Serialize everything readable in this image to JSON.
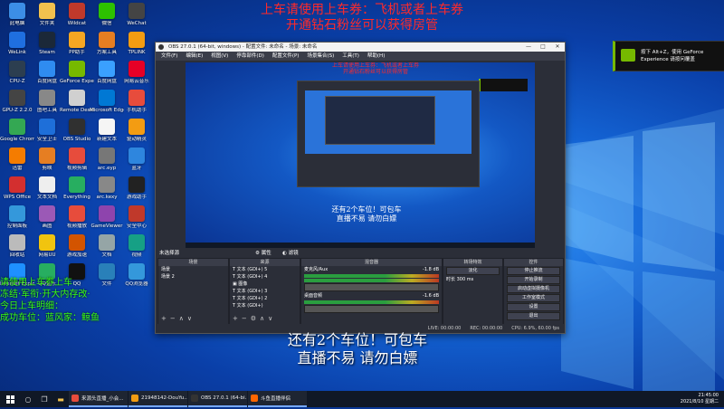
{
  "overlays": {
    "top_line1": "上车请使用上车券：飞机或者上车券",
    "top_line2": "开通钻石粉丝可以获得房管",
    "left_lines": [
      "请使用上车券上车",
      "冻结·军衔·开大内存改·",
      "今日上车明细：",
      "成功车位：蓝风家：鲸鱼"
    ],
    "bottom_line1": "还有2个车位！可包车",
    "bottom_line2": "直播不易 请勿白嫖"
  },
  "nvidia_toast": {
    "text": "按下 Alt+Z，使用 GeForce Experience 请按问覆盖"
  },
  "desktop_icons": [
    {
      "label": "此电脑",
      "color": "#3c8ee6"
    },
    {
      "label": "文件夹",
      "color": "#f2c14e"
    },
    {
      "label": "Wildcat",
      "color": "#c0392b"
    },
    {
      "label": "微信",
      "color": "#2dc100"
    },
    {
      "label": "WeChat",
      "color": "#444"
    },
    {
      "label": "WeLink",
      "color": "#1f6fe0"
    },
    {
      "label": "Steam",
      "color": "#1b2838"
    },
    {
      "label": "PP助手",
      "color": "#f5a623"
    },
    {
      "label": "方案工具",
      "color": "#e67e22"
    },
    {
      "label": "TPLINK",
      "color": "#f39c12"
    },
    {
      "label": "CPU-Z",
      "color": "#2c3e50"
    },
    {
      "label": "百度网盘",
      "color": "#2f8cf0"
    },
    {
      "label": "GeForce Experience",
      "color": "#76b900"
    },
    {
      "label": "百度网盘",
      "color": "#3aa0ff"
    },
    {
      "label": "网易云音乐",
      "color": "#e60026"
    },
    {
      "label": "GPU-Z 2.2.0",
      "color": "#444"
    },
    {
      "label": "图吧工具",
      "color": "#888"
    },
    {
      "label": "Remote Desktop",
      "color": "#d0d0d0"
    },
    {
      "label": "Microsoft Edge",
      "color": "#0078d4"
    },
    {
      "label": "手机助手",
      "color": "#e74c3c"
    },
    {
      "label": "Google Chrome",
      "color": "#34a853"
    },
    {
      "label": "安全卫士",
      "color": "#1e6fd9"
    },
    {
      "label": "OBS Studio",
      "color": "#303030"
    },
    {
      "label": "新建文本",
      "color": "#f5f5f5"
    },
    {
      "label": "驱动精灵",
      "color": "#f39c12"
    },
    {
      "label": "迅雷",
      "color": "#f57c00"
    },
    {
      "label": "剪映",
      "color": "#e67e22"
    },
    {
      "label": "视频剪辑",
      "color": "#e74c3c"
    },
    {
      "label": "arc.eyp",
      "color": "#777"
    },
    {
      "label": "蓝牙",
      "color": "#2e86de"
    },
    {
      "label": "WPS Office",
      "color": "#d32f2f"
    },
    {
      "label": "文本文档",
      "color": "#eee"
    },
    {
      "label": "Everything",
      "color": "#27ae60"
    },
    {
      "label": "arc.kexy",
      "color": "#888"
    },
    {
      "label": "游戏助手",
      "color": "#222"
    },
    {
      "label": "控制面板",
      "color": "#3498db"
    },
    {
      "label": "画图",
      "color": "#9b59b6"
    },
    {
      "label": "视频播放",
      "color": "#e74c3c"
    },
    {
      "label": "GameViewer",
      "color": "#8e44ad"
    },
    {
      "label": "安全中心",
      "color": "#c0392b"
    },
    {
      "label": "回收站",
      "color": "#bbb"
    },
    {
      "label": "网易UU",
      "color": "#f1c40f"
    },
    {
      "label": "游戏加速",
      "color": "#d35400"
    },
    {
      "label": "文档",
      "color": "#95a5a6"
    },
    {
      "label": "视频",
      "color": "#16a085"
    },
    {
      "label": "Internet Explorer",
      "color": "#1e90ff"
    },
    {
      "label": "QQ音乐",
      "color": "#27ae60"
    },
    {
      "label": "QQ",
      "color": "#111"
    },
    {
      "label": "文件",
      "color": "#2980b9"
    },
    {
      "label": "QQ浏览器",
      "color": "#3498db"
    }
  ],
  "obs": {
    "title": "OBS 27.0.1 (64-bit, windows) - 配置文件: 未命名 - 场景: 未命名",
    "menu": [
      "文件(F)",
      "编辑(E)",
      "视图(V)",
      "停靠部件(D)",
      "配置文件(P)",
      "场景集合(S)",
      "工具(T)",
      "帮助(H)"
    ],
    "win_buttons": [
      "—",
      "□",
      "✕"
    ],
    "no_source": "未选择源",
    "props_button": "属性",
    "filters_button": "滤镜",
    "nested_caption1": "还有2个车位！可包车",
    "nested_caption2": "直播不易 请勿白嫖",
    "docks": {
      "scenes": {
        "title": "场景",
        "items": [
          "场景",
          "场景 2"
        ]
      },
      "sources": {
        "title": "来源",
        "items": [
          "文本 (GDI+) 5",
          "文本 (GDI+) 4",
          "图像",
          "文本 (GDI+) 3",
          "文本 (GDI+) 2",
          "文本 (GDI+)"
        ]
      },
      "mixer": {
        "title": "混音器",
        "ch1": "麦克风/Aux",
        "ch1_db": "-1.8 dB",
        "ch2": "桌面音频",
        "ch2_db": "-1.6 dB"
      },
      "transitions": {
        "title": "转场特效",
        "type": "淡化",
        "duration_label": "时长",
        "duration": "300 ms"
      },
      "controls": {
        "title": "控件",
        "buttons": [
          "停止推流",
          "开始录制",
          "启动虚拟摄像机",
          "工作室模式",
          "设置",
          "退出"
        ]
      }
    },
    "status": {
      "live": "LIVE: 00:00:00",
      "rec": "REC: 00:00:00",
      "cpu": "CPU: 6.9%, 60.00 fps"
    }
  },
  "taskbar": {
    "apps": [
      {
        "label": "来源头直播_小会...",
        "color": "#e74c3c"
      },
      {
        "label": "21948142-DouYu...",
        "color": "#f39c12"
      },
      {
        "label": "OBS 27.0.1 (64-bi...",
        "color": "#333"
      },
      {
        "label": "斗鱼直播伴侣",
        "color": "#ff6600"
      }
    ],
    "time": "21:45:00",
    "date": "2021/8/10 星期二"
  }
}
